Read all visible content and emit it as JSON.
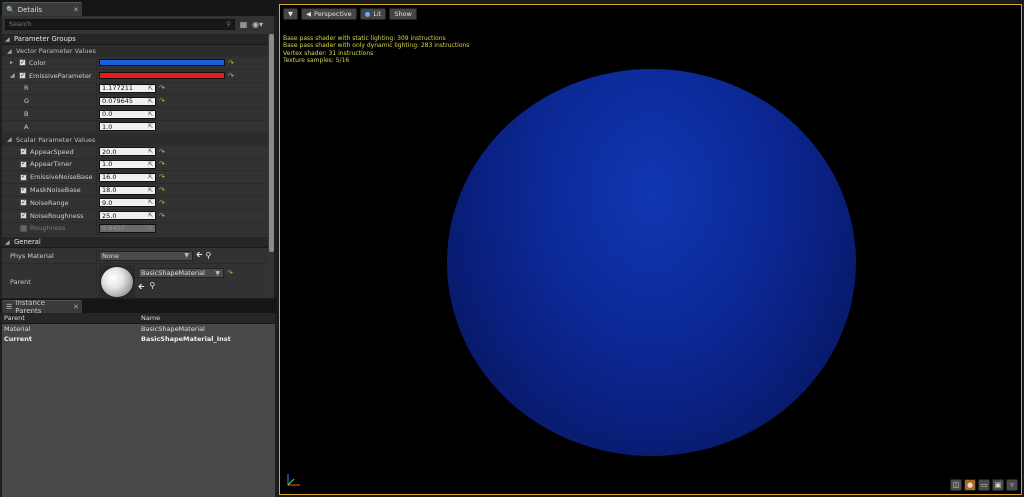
{
  "details_tab": {
    "label": "Details"
  },
  "search": {
    "placeholder": "Search"
  },
  "categories": {
    "parameter_groups": "Parameter Groups",
    "vector": "Vector Parameter Values",
    "scalar": "Scalar Parameter Values",
    "general": "General"
  },
  "vector_params": [
    {
      "name": "Color",
      "color": "#1a5fe0",
      "expanded": false
    },
    {
      "name": "EmissiveParameter",
      "color": "#e61c1c",
      "expanded": true
    }
  ],
  "emissive_channels": [
    {
      "name": "R",
      "value": "1.177211"
    },
    {
      "name": "G",
      "value": "0.079645"
    },
    {
      "name": "B",
      "value": "0.0"
    },
    {
      "name": "A",
      "value": "1.0"
    }
  ],
  "scalar_params": [
    {
      "name": "AppearSpeed",
      "value": "20.0",
      "enabled": true
    },
    {
      "name": "AppearTimer",
      "value": "1.0",
      "enabled": true
    },
    {
      "name": "EmissiveNoiseBase",
      "value": "16.0",
      "enabled": true
    },
    {
      "name": "MaskNoiseBase",
      "value": "18.0",
      "enabled": true
    },
    {
      "name": "NoiseRange",
      "value": "9.0",
      "enabled": true
    },
    {
      "name": "NoiseRoughness",
      "value": "25.0",
      "enabled": true
    },
    {
      "name": "Roughness",
      "value": "0.6407",
      "enabled": false
    }
  ],
  "general": {
    "phys_material_label": "Phys Material",
    "phys_material_value": "None",
    "parent_label": "Parent",
    "parent_value": "BasicShapeMaterial"
  },
  "instance_parents": {
    "tab_label": "Instance Parents",
    "headers": [
      "Parent",
      "Name"
    ],
    "rows": [
      [
        "Material",
        "BasicShapeMaterial"
      ],
      [
        "Current",
        "BasicShapeMaterial_Inst"
      ]
    ]
  },
  "viewport": {
    "perspective_label": "Perspective",
    "lit_label": "Lit",
    "show_label": "Show",
    "stats": [
      "Base pass shader with static lighting: 309 instructions",
      "Base pass shader with only dynamic lighting: 283 instructions",
      "Vertex shader: 31 instructions",
      "Texture samples: 5/16"
    ]
  }
}
